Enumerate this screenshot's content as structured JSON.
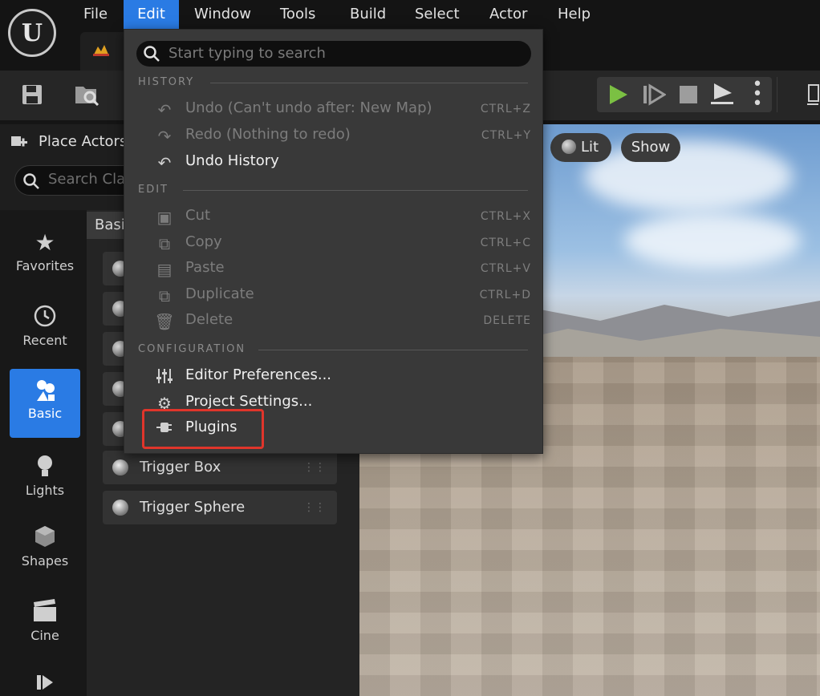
{
  "app": {
    "logo_letter": "U"
  },
  "menubar": {
    "items": [
      {
        "label": "File"
      },
      {
        "label": "Edit"
      },
      {
        "label": "Window"
      },
      {
        "label": "Tools"
      },
      {
        "label": "Build"
      },
      {
        "label": "Select"
      },
      {
        "label": "Actor"
      },
      {
        "label": "Help"
      }
    ],
    "active": "Edit"
  },
  "place_actors": {
    "title": "Place Actors",
    "search_placeholder": "Search Classes",
    "tab_label": "Basic",
    "categories": [
      {
        "label": "Favorites",
        "icon": "star-icon"
      },
      {
        "label": "Recent",
        "icon": "clock-icon"
      },
      {
        "label": "Basic",
        "icon": "shapes-icon",
        "active": true
      },
      {
        "label": "Lights",
        "icon": "lightbulb-icon"
      },
      {
        "label": "Shapes",
        "icon": "cube-icon"
      },
      {
        "label": "Cine",
        "icon": "clapperboard-icon"
      }
    ],
    "items": [
      {
        "label": "Trigger Box"
      },
      {
        "label": "Trigger Sphere"
      }
    ]
  },
  "viewport": {
    "lit_label": "Lit",
    "show_label": "Show"
  },
  "edit_menu": {
    "search_placeholder": "Start typing to search",
    "sections": {
      "history": "HISTORY",
      "edit": "EDIT",
      "configuration": "CONFIGURATION"
    },
    "history": [
      {
        "label": "Undo (Can't undo after: New Map)",
        "shortcut": "CTRL+Z",
        "icon": "undo-icon",
        "enabled": false
      },
      {
        "label": "Redo (Nothing to redo)",
        "shortcut": "CTRL+Y",
        "icon": "redo-icon",
        "enabled": false
      },
      {
        "label": "Undo History",
        "shortcut": "",
        "icon": "undo-history-icon",
        "enabled": true
      }
    ],
    "edit": [
      {
        "label": "Cut",
        "shortcut": "CTRL+X",
        "icon": "cut-icon",
        "enabled": false
      },
      {
        "label": "Copy",
        "shortcut": "CTRL+C",
        "icon": "copy-icon",
        "enabled": false
      },
      {
        "label": "Paste",
        "shortcut": "CTRL+V",
        "icon": "paste-icon",
        "enabled": false
      },
      {
        "label": "Duplicate",
        "shortcut": "CTRL+D",
        "icon": "duplicate-icon",
        "enabled": false
      },
      {
        "label": "Delete",
        "shortcut": "DELETE",
        "icon": "trash-icon",
        "enabled": false
      }
    ],
    "configuration": [
      {
        "label": "Editor Preferences...",
        "icon": "sliders-icon",
        "enabled": true
      },
      {
        "label": "Project Settings...",
        "icon": "settings-gear-icon",
        "enabled": true
      },
      {
        "label": "Plugins",
        "icon": "plugin-icon",
        "enabled": true,
        "highlighted": true
      }
    ]
  },
  "colors": {
    "accent": "#2a7be4",
    "highlight_box": "#e0352b",
    "play": "#7bc043"
  }
}
